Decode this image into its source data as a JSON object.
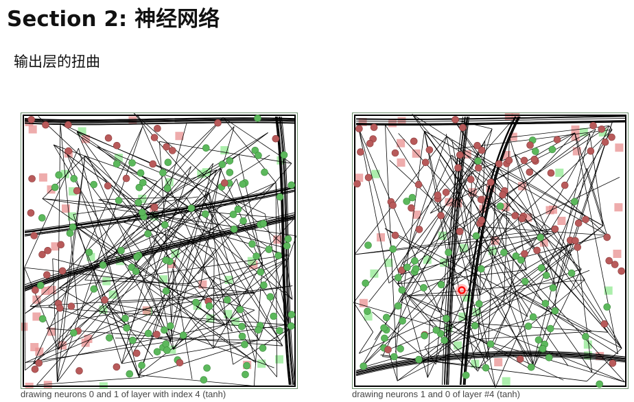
{
  "slide": {
    "title": "Section 2:  神经网络",
    "subtitle": "输出层的扭曲"
  },
  "colors": {
    "red_point": "#b85a5a",
    "red_square": "#e89090",
    "green_point": "#5cb85c",
    "green_square": "#90e890",
    "line": "#000000",
    "cursor": "#ff0000"
  },
  "panels": [
    {
      "caption": "drawing neurons 0 and 1 of layer with index 4 (tanh)"
    },
    {
      "caption": "drawing neurons 1 and 0 of layer #4 (tanh)",
      "has_cursor": true
    }
  ]
}
